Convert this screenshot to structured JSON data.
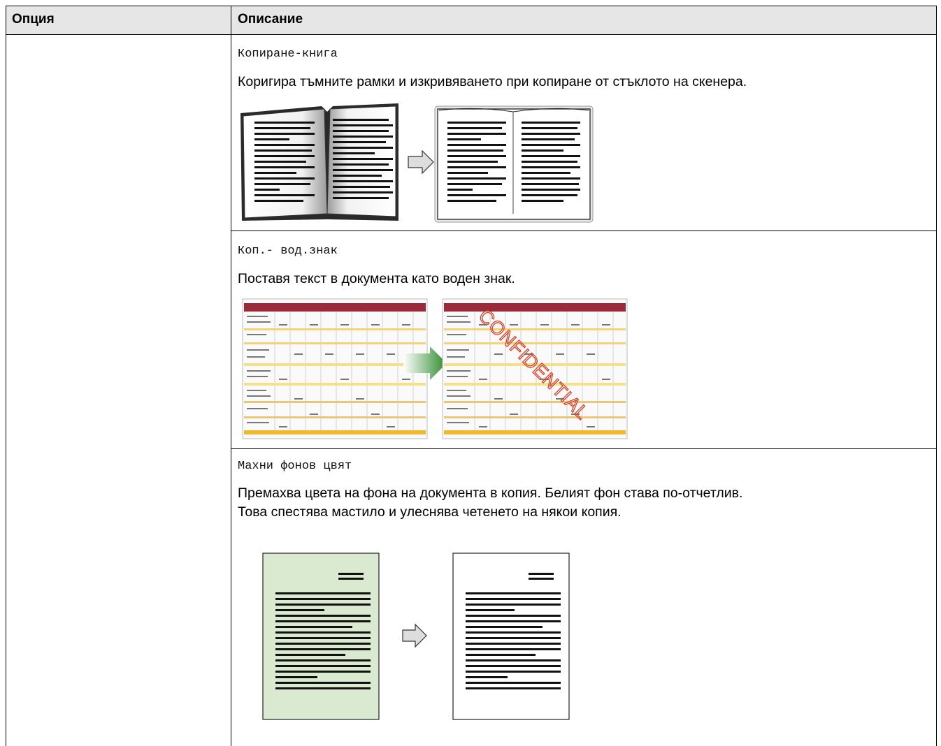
{
  "table": {
    "headers": {
      "option": "Опция",
      "description": "Описание"
    },
    "rows": [
      {
        "setting": "Копиране-книга",
        "description": "Коригира тъмните рамки и изкривяването при копиране от стъклото на скенера.",
        "illustration": "book-copy-illustration"
      },
      {
        "setting": "Коп.- вод.знак",
        "description": "Поставя текст в документа като воден знак.",
        "illustration": "watermark-copy-illustration",
        "watermark_text": "CONFIDENTIAL"
      },
      {
        "setting": "Махни фонов цвят",
        "description_lines": [
          "Премахва цвета на фона на документа в копия. Белият фон става по-отчетлив.",
          "Това спестява мастило и улеснява четенето на някои копия."
        ],
        "illustration": "remove-background-illustration"
      }
    ]
  },
  "colors": {
    "header_bg": "#e6e6e6",
    "border": "#000000",
    "green_page": "#d9ead0",
    "watermark_red": "#d9432a",
    "spreadsheet_header": "#9b2b3a",
    "arrow_green": "#2c8a2c"
  }
}
